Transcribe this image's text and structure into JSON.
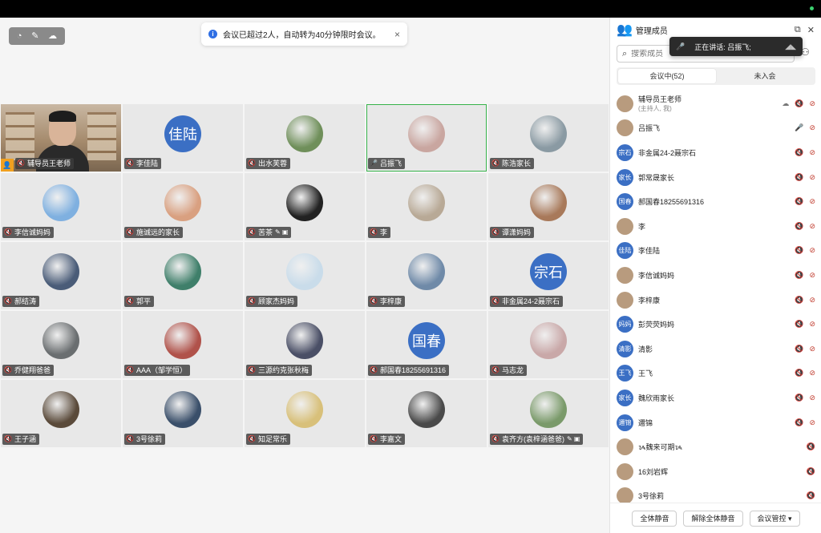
{
  "toast": {
    "message": "会议已超过2人，自动转为40分钟限时会议。",
    "close": "×"
  },
  "controls": {
    "icons": [
      "◔",
      "✎",
      "☁"
    ]
  },
  "tiles": [
    {
      "name": "辅导员王老师",
      "type": "camera",
      "host": true
    },
    {
      "name": "李佳陆",
      "type": "text",
      "avatar": "佳陆"
    },
    {
      "name": "出水芙蓉",
      "type": "photo",
      "color": "#6f8f5a"
    },
    {
      "name": "吕振飞",
      "type": "photo",
      "color": "#c9a6a0",
      "speaking": true
    },
    {
      "name": "陈浩家长",
      "type": "photo",
      "color": "#8a9aa3"
    },
    {
      "name": "李信诚妈妈",
      "type": "photo",
      "color": "#7fb0e0"
    },
    {
      "name": "施诚远的家长",
      "type": "photo",
      "color": "#d9a080"
    },
    {
      "name": "苦茶",
      "type": "photo",
      "color": "#222222",
      "ext": "✎ ▣"
    },
    {
      "name": "李",
      "type": "photo",
      "color": "#b8a996"
    },
    {
      "name": "谭潇妈妈",
      "type": "photo",
      "color": "#a8795a"
    },
    {
      "name": "郝结涛",
      "type": "photo",
      "color": "#4a5c78"
    },
    {
      "name": "郭平",
      "type": "photo",
      "color": "#3f7f6a"
    },
    {
      "name": "顾家杰妈妈",
      "type": "photo",
      "color": "#c9dcea"
    },
    {
      "name": "李梓康",
      "type": "photo",
      "color": "#6f8aa8"
    },
    {
      "name": "非金属24-2聂宗石",
      "type": "text",
      "avatar": "宗石"
    },
    {
      "name": "乔健翔爸爸",
      "type": "photo",
      "color": "#6a6e70"
    },
    {
      "name": "AAA（邹学恒）",
      "type": "photo",
      "color": "#b0524a"
    },
    {
      "name": "三源约克张秋梅",
      "type": "photo",
      "color": "#4a4f66"
    },
    {
      "name": "郝国春18255691316",
      "type": "text",
      "avatar": "国春"
    },
    {
      "name": "马志龙",
      "type": "photo",
      "color": "#c9a8a8"
    },
    {
      "name": "王子涵",
      "type": "photo",
      "color": "#5a4a3a"
    },
    {
      "name": "3号徐莉",
      "type": "photo",
      "color": "#3a4f6a"
    },
    {
      "name": "知足常乐",
      "type": "photo",
      "color": "#d8c07a"
    },
    {
      "name": "李嘉文",
      "type": "photo",
      "color": "#4a4a4a"
    },
    {
      "name": "袁齐方(袁梓涵爸爸)",
      "type": "photo",
      "color": "#7a9a6a",
      "ext": "✎ ▣"
    }
  ],
  "panel": {
    "title": "管理成员",
    "search_placeholder": "搜索成员",
    "speaking_label": "正在讲话:  吕振飞;",
    "tabs": [
      "会议中(52)",
      "未入会"
    ],
    "members": [
      {
        "name": "辅导员王老师",
        "sub": "(主持人, 我)",
        "avatar": "",
        "photo": true
      },
      {
        "name": "吕振飞",
        "avatar": "",
        "photo": true,
        "mic_on": true
      },
      {
        "name": "非金属24-2聂宗石",
        "avatar": "宗石"
      },
      {
        "name": "郭常晟家长",
        "avatar": "家长"
      },
      {
        "name": "郝国春18255691316",
        "avatar": "国春"
      },
      {
        "name": "李",
        "avatar": "",
        "photo": true
      },
      {
        "name": "李佳陆",
        "avatar": "佳陆"
      },
      {
        "name": "李信诚妈妈",
        "avatar": "",
        "photo": true
      },
      {
        "name": "李梓康",
        "avatar": "",
        "photo": true
      },
      {
        "name": "彭荧荧妈妈",
        "avatar": "妈妈"
      },
      {
        "name": "清影",
        "avatar": "清影"
      },
      {
        "name": "王飞",
        "avatar": "王飞"
      },
      {
        "name": "魏欣雨家长",
        "avatar": "家长"
      },
      {
        "name": "邇锦",
        "avatar": "邇锦"
      },
      {
        "name": "ᝰ魏来可期ᝰ",
        "avatar": "",
        "photo": true,
        "no_video": true
      },
      {
        "name": "16刘岩辉",
        "avatar": "",
        "photo": true,
        "no_video": true
      },
      {
        "name": "3号徐莉",
        "avatar": "",
        "photo": true,
        "no_video": true
      }
    ],
    "footer": {
      "mute_all": "全体静音",
      "unmute_all": "解除全体静音",
      "controls": "会议管控 ▾"
    }
  }
}
